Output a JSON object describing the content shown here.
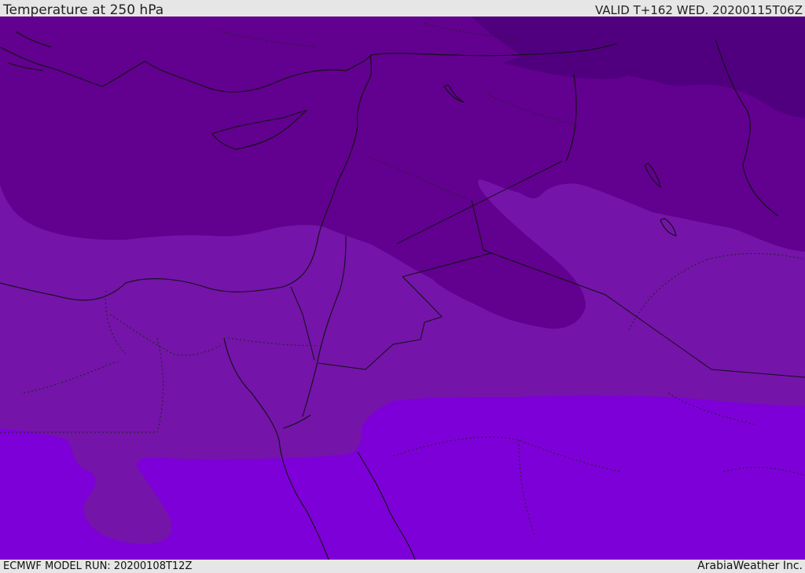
{
  "header": {
    "title": "Temperature at 250 hPa",
    "valid": "VALID T+162 WED. 20200115T06Z"
  },
  "footer": {
    "model_run": "ECMWF MODEL RUN: 20200108T12Z",
    "brand": "ArabiaWeather Inc."
  },
  "colors": {
    "band_coldest": "#50007f",
    "band_cold": "#62008f",
    "band_mid": "#7414a9",
    "band_warm": "#7e00d8",
    "lines": "#111111"
  }
}
